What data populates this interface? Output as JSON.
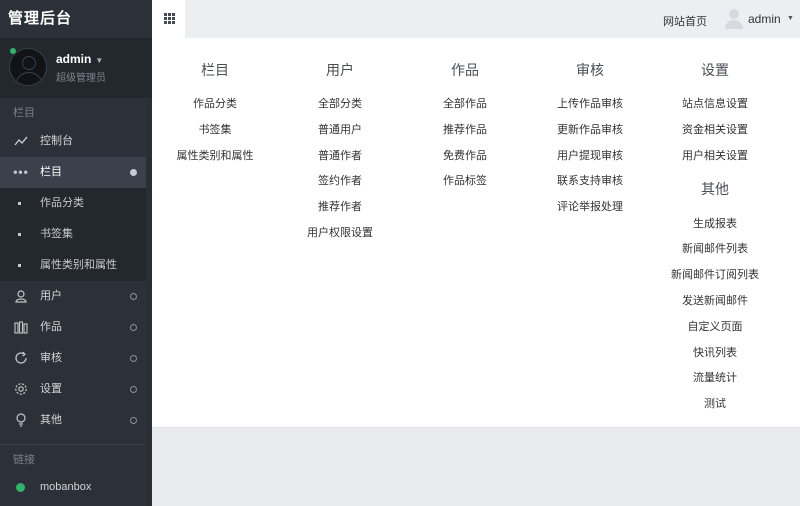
{
  "brand": "管理后台",
  "user": {
    "name": "admin",
    "role": "超级管理员"
  },
  "sidebar": {
    "section_nav": "栏目",
    "items": [
      {
        "label": "控制台",
        "icon": "chart-line-icon"
      },
      {
        "label": "栏目",
        "icon": "more-dots-icon",
        "active": true
      },
      {
        "label": "用户",
        "icon": "user-icon"
      },
      {
        "label": "作品",
        "icon": "books-icon"
      },
      {
        "label": "审核",
        "icon": "refresh-icon"
      },
      {
        "label": "设置",
        "icon": "gear-icon"
      },
      {
        "label": "其他",
        "icon": "bulb-icon"
      }
    ],
    "sub_items": [
      "作品分类",
      "书签集",
      "属性类别和属性"
    ],
    "section_links": "链接",
    "links": [
      {
        "label": "mobanbox",
        "color": "#2fb56a"
      }
    ]
  },
  "topbar": {
    "home_link": "网站首页",
    "user": "admin"
  },
  "menu": {
    "columns": [
      {
        "title": "栏目",
        "items": [
          "作品分类",
          "书签集",
          "属性类别和属性"
        ]
      },
      {
        "title": "用户",
        "items": [
          "全部分类",
          "普通用户",
          "普通作者",
          "签约作者",
          "推荐作者",
          "用户权限设置"
        ]
      },
      {
        "title": "作品",
        "items": [
          "全部作品",
          "推荐作品",
          "免费作品",
          "作品标签"
        ]
      },
      {
        "title": "审核",
        "items": [
          "上传作品审核",
          "更新作品审核",
          "用户提现审核",
          "联系支持审核",
          "评论举报处理"
        ]
      },
      {
        "title": "设置",
        "items": [
          "站点信息设置",
          "资金相关设置",
          "用户相关设置"
        ],
        "sub_title": "其他",
        "sub_items": [
          "生成报表",
          "新闻邮件列表",
          "新闻邮件订阅列表",
          "发送新闻邮件",
          "自定义页面",
          "快讯列表",
          "流量统计",
          "测试"
        ]
      }
    ]
  },
  "colors": {
    "sidebar_bg": "#2c3038",
    "accent_green": "#2fb56a",
    "active_bg": "#3b414b"
  }
}
